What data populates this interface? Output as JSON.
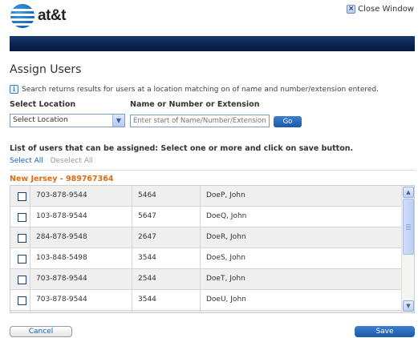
{
  "brand": {
    "logo_text": "at&t",
    "logo_icon": "globe-icon"
  },
  "header": {
    "close_label": "Close Window",
    "close_icon": "close-x-icon"
  },
  "page": {
    "title": "Assign Users"
  },
  "info": {
    "icon": "info-icon",
    "text": "Search returns results for users at a location matching on of name and number/extension entered."
  },
  "search": {
    "location_label": "Select Location",
    "location_value": "Select Location",
    "name_label": "Name or Number or Extension",
    "name_placeholder": "Enter start of Name/Number/Extension",
    "go_label": "Go"
  },
  "list": {
    "heading": "List of users that can be assigned: Select one or more and click on save button.",
    "select_all": "Select All",
    "deselect_all": "Deselect All",
    "group_title": "New Jersey - 989767364",
    "rows": [
      {
        "number": "703-878-9544",
        "extension": "5464",
        "name": "DoeP, John"
      },
      {
        "number": "103-878-9544",
        "extension": "5647",
        "name": "DoeQ, John"
      },
      {
        "number": "284-878-9548",
        "extension": "2647",
        "name": "DoeR, John"
      },
      {
        "number": "103-848-5498",
        "extension": "3544",
        "name": "DoeS, John"
      },
      {
        "number": "703-878-9544",
        "extension": "2544",
        "name": "DoeT, John"
      },
      {
        "number": "703-878-9544",
        "extension": "3544",
        "name": "DoeU, John"
      },
      {
        "number": "",
        "extension": "",
        "name": ""
      }
    ]
  },
  "footer": {
    "cancel_label": "Cancel",
    "save_label": "Save"
  },
  "colors": {
    "accent": "#1a58a8",
    "header_bar": "#0b2451",
    "group_title": "#e36b12",
    "link": "#1a5fb4"
  }
}
